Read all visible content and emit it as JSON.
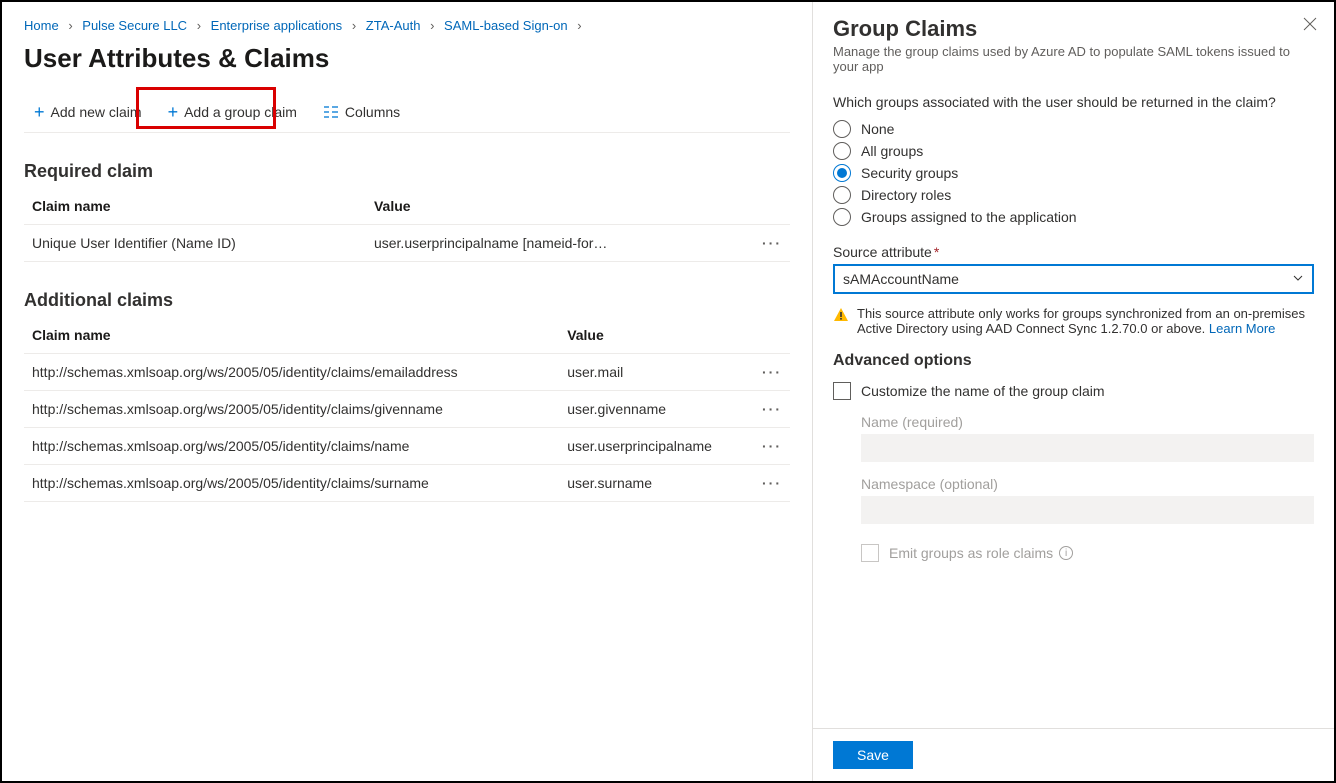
{
  "breadcrumb": {
    "items": [
      {
        "label": "Home"
      },
      {
        "label": "Pulse Secure LLC"
      },
      {
        "label": "Enterprise applications"
      },
      {
        "label": "ZTA-Auth"
      },
      {
        "label": "SAML-based Sign-on"
      }
    ]
  },
  "page_title": "User Attributes & Claims",
  "toolbar": {
    "add_new_claim": "Add new claim",
    "add_group_claim": "Add a group claim",
    "columns": "Columns"
  },
  "required": {
    "title": "Required claim",
    "col_name": "Claim name",
    "col_value": "Value",
    "rows": [
      {
        "name": "Unique User Identifier (Name ID)",
        "value": "user.userprincipalname [nameid-for…"
      }
    ]
  },
  "additional": {
    "title": "Additional claims",
    "col_name": "Claim name",
    "col_value": "Value",
    "rows": [
      {
        "name": "http://schemas.xmlsoap.org/ws/2005/05/identity/claims/emailaddress",
        "value": "user.mail"
      },
      {
        "name": "http://schemas.xmlsoap.org/ws/2005/05/identity/claims/givenname",
        "value": "user.givenname"
      },
      {
        "name": "http://schemas.xmlsoap.org/ws/2005/05/identity/claims/name",
        "value": "user.userprincipalname"
      },
      {
        "name": "http://schemas.xmlsoap.org/ws/2005/05/identity/claims/surname",
        "value": "user.surname"
      }
    ]
  },
  "panel": {
    "title": "Group Claims",
    "subtitle": "Manage the group claims used by Azure AD to populate SAML tokens issued to your app",
    "question": "Which groups associated with the user should be returned in the claim?",
    "options": {
      "none": "None",
      "all": "All groups",
      "security": "Security groups",
      "directory": "Directory roles",
      "assigned": "Groups assigned to the application"
    },
    "source_label": "Source attribute",
    "source_value": "sAMAccountName",
    "warning_text": "This source attribute only works for groups synchronized from an on-premises Active Directory using AAD Connect Sync 1.2.70.0 or above.",
    "learn_more": "Learn More",
    "advanced_title": "Advanced options",
    "customize_label": "Customize the name of the group claim",
    "name_label": "Name (required)",
    "namespace_label": "Namespace (optional)",
    "emit_label": "Emit groups as role claims",
    "save": "Save"
  }
}
